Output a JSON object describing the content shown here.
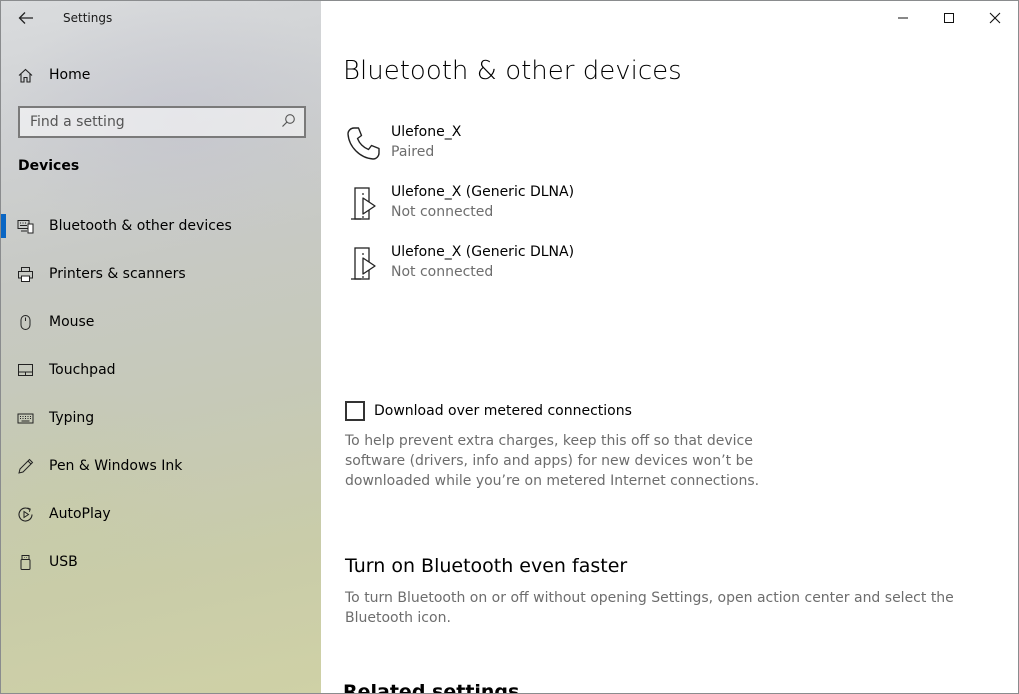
{
  "window": {
    "app_title": "Settings",
    "minimize_glyph": "",
    "maximize_glyph": "",
    "close_glyph": ""
  },
  "sidebar": {
    "home_label": "Home",
    "search": {
      "placeholder": "Find a setting",
      "value": ""
    },
    "section_title": "Devices",
    "items": [
      {
        "label": "Bluetooth & other devices",
        "icon": "bluetooth-devices-icon",
        "selected": true
      },
      {
        "label": "Printers & scanners",
        "icon": "printer-icon",
        "selected": false
      },
      {
        "label": "Mouse",
        "icon": "mouse-icon",
        "selected": false
      },
      {
        "label": "Touchpad",
        "icon": "touchpad-icon",
        "selected": false
      },
      {
        "label": "Typing",
        "icon": "keyboard-icon",
        "selected": false
      },
      {
        "label": "Pen & Windows Ink",
        "icon": "pen-icon",
        "selected": false
      },
      {
        "label": "AutoPlay",
        "icon": "autoplay-icon",
        "selected": false
      },
      {
        "label": "USB",
        "icon": "usb-icon",
        "selected": false
      }
    ]
  },
  "main": {
    "page_title": "Bluetooth & other devices",
    "devices": [
      {
        "name": "Ulefone_X",
        "status": "Paired",
        "icon": "phone-icon"
      },
      {
        "name": "Ulefone_X (Generic DLNA)",
        "status": "Not connected",
        "icon": "media-device-icon"
      },
      {
        "name": "Ulefone_X (Generic DLNA)",
        "status": "Not connected",
        "icon": "media-device-icon"
      }
    ],
    "metered": {
      "label": "Download over metered connections",
      "checked": false,
      "help": "To help prevent extra charges, keep this off so that device software (drivers, info and apps) for new devices won’t be downloaded while you’re on metered Internet connections."
    },
    "faster": {
      "heading": "Turn on Bluetooth even faster",
      "help": "To turn Bluetooth on or off without opening Settings, open action center and select the Bluetooth icon."
    },
    "related_heading": "Related settings"
  },
  "colors": {
    "accent": "#0a66c4",
    "secondary_text": "#6d6d6d"
  }
}
